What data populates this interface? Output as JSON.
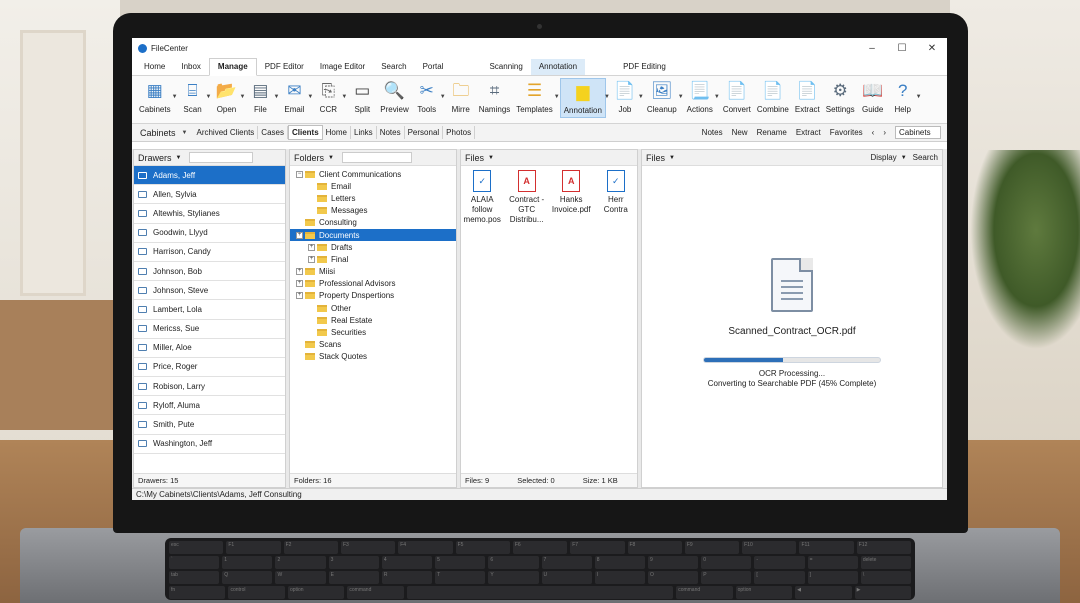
{
  "app": {
    "title": "FileCenter",
    "win_min": "–",
    "win_max": "☐",
    "win_close": "✕"
  },
  "tabs": [
    "Home",
    "Inbox",
    "Manage",
    "PDF Editor",
    "Image Editor",
    "Search",
    "Portal",
    "Scanning",
    "Annotation",
    "PDF Editing"
  ],
  "ribbon": [
    {
      "label": "Cabinets",
      "icon": "▦",
      "color": "#3b7fc4"
    },
    {
      "label": "Scan",
      "icon": "⌸",
      "color": "#3b7fc4"
    },
    {
      "label": "Open",
      "icon": "📂",
      "color": "#e3a42b"
    },
    {
      "label": "File",
      "icon": "▤",
      "color": "#5a6b7c"
    },
    {
      "label": "Email",
      "icon": "✉",
      "color": "#3b7fc4"
    },
    {
      "label": "CCR",
      "icon": "⎘",
      "color": "#6a6a6a"
    },
    {
      "label": "Split",
      "icon": "▭",
      "color": "#444"
    },
    {
      "label": "Preview",
      "icon": "🔍",
      "color": "#444"
    },
    {
      "label": "Tools",
      "icon": "✂",
      "color": "#3b7fc4"
    },
    {
      "label": "Mirre",
      "icon": "🗀",
      "color": "#e3a42b"
    },
    {
      "label": "Namings",
      "icon": "⌗",
      "color": "#5a6b7c"
    },
    {
      "label": "Templates",
      "icon": "☰",
      "color": "#e3a42b"
    },
    {
      "label": "Annotation",
      "icon": "▆",
      "color": "#f4d21f"
    },
    {
      "label": "Job",
      "icon": "📄",
      "color": "#8a5fb0"
    },
    {
      "label": "Cleanup",
      "icon": "🖼",
      "color": "#3b7fc4"
    },
    {
      "label": "Actions",
      "icon": "📃",
      "color": "#3aa35a"
    },
    {
      "label": "Convert",
      "icon": "📄",
      "color": "#e3a42b"
    },
    {
      "label": "Combine",
      "icon": "📄",
      "color": "#3aa35a"
    },
    {
      "label": "Extract",
      "icon": "📄",
      "color": "#3b7fc4"
    },
    {
      "label": "Settings",
      "icon": "⚙",
      "color": "#5a6b7c"
    },
    {
      "label": "Guide",
      "icon": "📖",
      "color": "#5a6b7c"
    },
    {
      "label": "Help",
      "icon": "?",
      "color": "#3b7fc4"
    }
  ],
  "nav": {
    "cabinets": "Cabinets",
    "tabs": [
      "Archived Clients",
      "Cases",
      "Clients",
      "Home",
      "Links",
      "Notes",
      "Personal",
      "Photos"
    ],
    "right": [
      "Notes",
      "New",
      "Rename",
      "Extract",
      "Favorites"
    ],
    "cab_select": "Cabinets"
  },
  "drawers": {
    "title": "Drawers",
    "items": [
      "Adams, Jeff",
      "Allen, Sylvia",
      "Altewhis, Stylianes",
      "Goodwin, Llyyd",
      "Harrison, Candy",
      "Johnson, Bob",
      "Johnson, Steve",
      "Lambert, Lola",
      "Mericss, Sue",
      "Miller, Aloe",
      "Price, Roger",
      "Robison, Larry",
      "Ryloff, Aluma",
      "Smith, Pute",
      "Washington, Jeff"
    ],
    "footer": "Drawers: 15"
  },
  "folders": {
    "title": "Folders",
    "tree": [
      {
        "label": "Client Communications",
        "indent": 0,
        "exp": "−"
      },
      {
        "label": "Email",
        "indent": 1,
        "exp": ""
      },
      {
        "label": "Letters",
        "indent": 1,
        "exp": ""
      },
      {
        "label": "Messages",
        "indent": 1,
        "exp": ""
      },
      {
        "label": "Consulting",
        "indent": 0,
        "exp": ""
      },
      {
        "label": "Documents",
        "indent": 0,
        "exp": "+"
      },
      {
        "label": "Drafts",
        "indent": 1,
        "exp": "+"
      },
      {
        "label": "Final",
        "indent": 1,
        "exp": "+"
      },
      {
        "label": "Miisi",
        "indent": 0,
        "exp": "+"
      },
      {
        "label": "Professional Advisors",
        "indent": 0,
        "exp": "+"
      },
      {
        "label": "Property Dnspertions",
        "indent": 0,
        "exp": "+"
      },
      {
        "label": "Other",
        "indent": 1,
        "exp": ""
      },
      {
        "label": "Real Estate",
        "indent": 1,
        "exp": ""
      },
      {
        "label": "Securities",
        "indent": 1,
        "exp": ""
      },
      {
        "label": "Scans",
        "indent": 0,
        "exp": ""
      },
      {
        "label": "Stack Quotes",
        "indent": 0,
        "exp": ""
      }
    ],
    "footer": "Folders: 16"
  },
  "files": {
    "title": "Files",
    "items": [
      {
        "name": "ALAIA follow memo.pos",
        "type": "doc",
        "glyph": "✓"
      },
      {
        "name": "Contract - GTC Distribu...",
        "type": "pdf",
        "glyph": "A"
      },
      {
        "name": "Hanks Invoice.pdf",
        "type": "pdf",
        "glyph": "A"
      },
      {
        "name": "Herr Contra",
        "type": "doc",
        "glyph": "✓"
      }
    ],
    "footer_count": "Files: 9",
    "footer_selected": "Selected: 0",
    "footer_size": "Size: 1 KB"
  },
  "preview": {
    "title": "Files",
    "display": "Display",
    "search": "Search",
    "filename": "Scanned_Contract_OCR.pdf",
    "progress": 0.45,
    "status1": "OCR Processing...",
    "status2": "Converting to Searchable PDF (45% Complete)"
  },
  "statusbar": "C:\\My Cabinets\\Clients\\Adams, Jeff Consulting",
  "keyboard": {
    "row1": [
      "esc",
      "F1",
      "F2",
      "F3",
      "F4",
      "F5",
      "F6",
      "F7",
      "F8",
      "F9",
      "F10",
      "F11",
      "F12"
    ],
    "row2": [
      "`",
      "1",
      "2",
      "3",
      "4",
      "5",
      "6",
      "7",
      "8",
      "9",
      "0",
      "-",
      "=",
      "delete"
    ],
    "row3": [
      "tab",
      "Q",
      "W",
      "E",
      "R",
      "T",
      "Y",
      "U",
      "I",
      "O",
      "P",
      "[",
      "]",
      "\\"
    ],
    "row4": [
      "fn",
      "control",
      "option",
      "command",
      "",
      "command",
      "option",
      "◀",
      "▶"
    ]
  }
}
